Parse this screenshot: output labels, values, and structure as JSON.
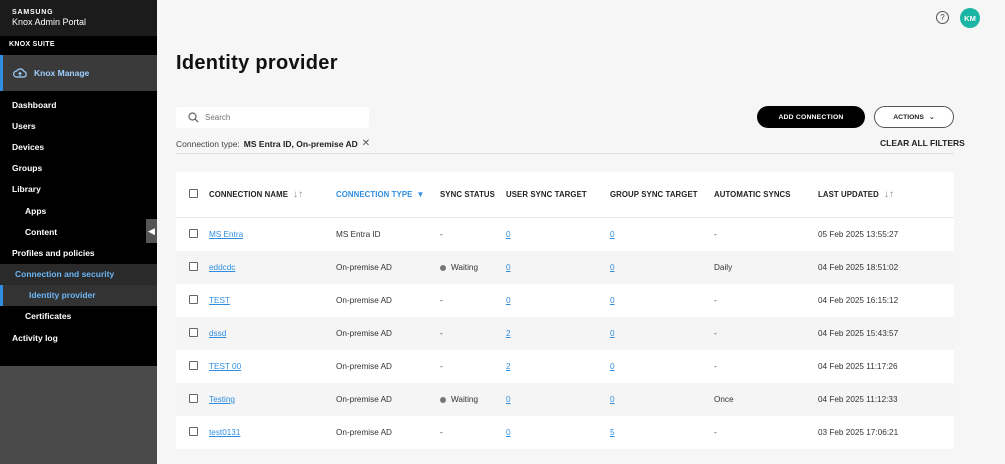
{
  "brand": {
    "company": "SAMSUNG",
    "product": "Knox Admin Portal"
  },
  "suite_label": "KNOX SUITE",
  "app_name": "Knox Manage",
  "nav": {
    "dashboard": "Dashboard",
    "users": "Users",
    "devices": "Devices",
    "groups": "Groups",
    "library": "Library",
    "apps": "Apps",
    "content": "Content",
    "profiles": "Profiles and policies",
    "connection": "Connection and security",
    "identity": "Identity provider",
    "certificates": "Certificates",
    "activity": "Activity log"
  },
  "user": {
    "initials": "KM",
    "help": "?"
  },
  "page_title": "Identity provider",
  "search": {
    "placeholder": "Search"
  },
  "buttons": {
    "add": "ADD CONNECTION",
    "actions": "ACTIONS"
  },
  "filter": {
    "label": "Connection type:",
    "value": "MS Entra ID, On-premise AD",
    "clear": "CLEAR ALL FILTERS"
  },
  "colors": {
    "accent": "#2f8ee0",
    "avatar": "#1bb5a3"
  },
  "table": {
    "headers": {
      "name": "CONNECTION NAME",
      "type": "CONNECTION TYPE",
      "status": "SYNC STATUS",
      "user_target": "USER SYNC TARGET",
      "group_target": "GROUP SYNC TARGET",
      "auto": "AUTOMATIC SYNCS",
      "updated": "LAST UPDATED"
    },
    "rows": [
      {
        "name": "MS Entra",
        "type": "MS Entra ID",
        "status": "-",
        "user": "0",
        "group": "0",
        "auto": "-",
        "updated": "05 Feb 2025 13:55:27"
      },
      {
        "name": "eddcdc",
        "type": "On-premise AD",
        "status": "Waiting",
        "user": "0",
        "group": "0",
        "auto": "Daily",
        "updated": "04 Feb 2025 18:51:02"
      },
      {
        "name": "TEST",
        "type": "On-premise AD",
        "status": "-",
        "user": "0",
        "group": "0",
        "auto": "-",
        "updated": "04 Feb 2025 16:15:12"
      },
      {
        "name": "dssd",
        "type": "On-premise AD",
        "status": "-",
        "user": "2",
        "group": "0",
        "auto": "-",
        "updated": "04 Feb 2025 15:43:57"
      },
      {
        "name": "TEST 00",
        "type": "On-premise AD",
        "status": "-",
        "user": "2",
        "group": "0",
        "auto": "-",
        "updated": "04 Feb 2025 11:17:26"
      },
      {
        "name": "Testing",
        "type": "On-premise AD",
        "status": "Waiting",
        "user": "0",
        "group": "0",
        "auto": "Once",
        "updated": "04 Feb 2025 11:12:33"
      },
      {
        "name": "test0131",
        "type": "On-premise AD",
        "status": "-",
        "user": "0",
        "group": "5",
        "auto": "-",
        "updated": "03 Feb 2025 17:06:21"
      }
    ]
  }
}
